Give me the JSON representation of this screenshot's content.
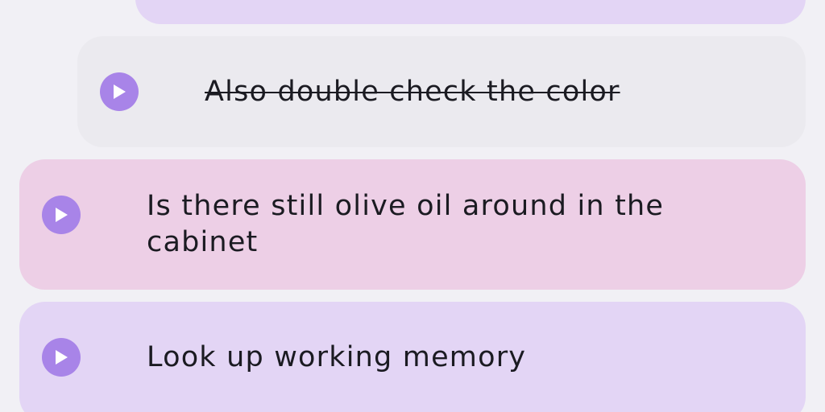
{
  "tasks": [
    {
      "label": "",
      "state": "partial-visible",
      "color": "#e3d5f5"
    },
    {
      "label": "Also double check the color",
      "state": "completed",
      "color": "#ebeaef"
    },
    {
      "label": "Is there still olive oil around in the cabinet",
      "state": "active",
      "color": "#edcfe6"
    },
    {
      "label": "Look up working memory",
      "state": "active",
      "color": "#e3d5f5"
    }
  ],
  "icons": {
    "play": "play-icon"
  },
  "colors": {
    "accent": "#a884e8",
    "background": "#f1f0f5"
  }
}
